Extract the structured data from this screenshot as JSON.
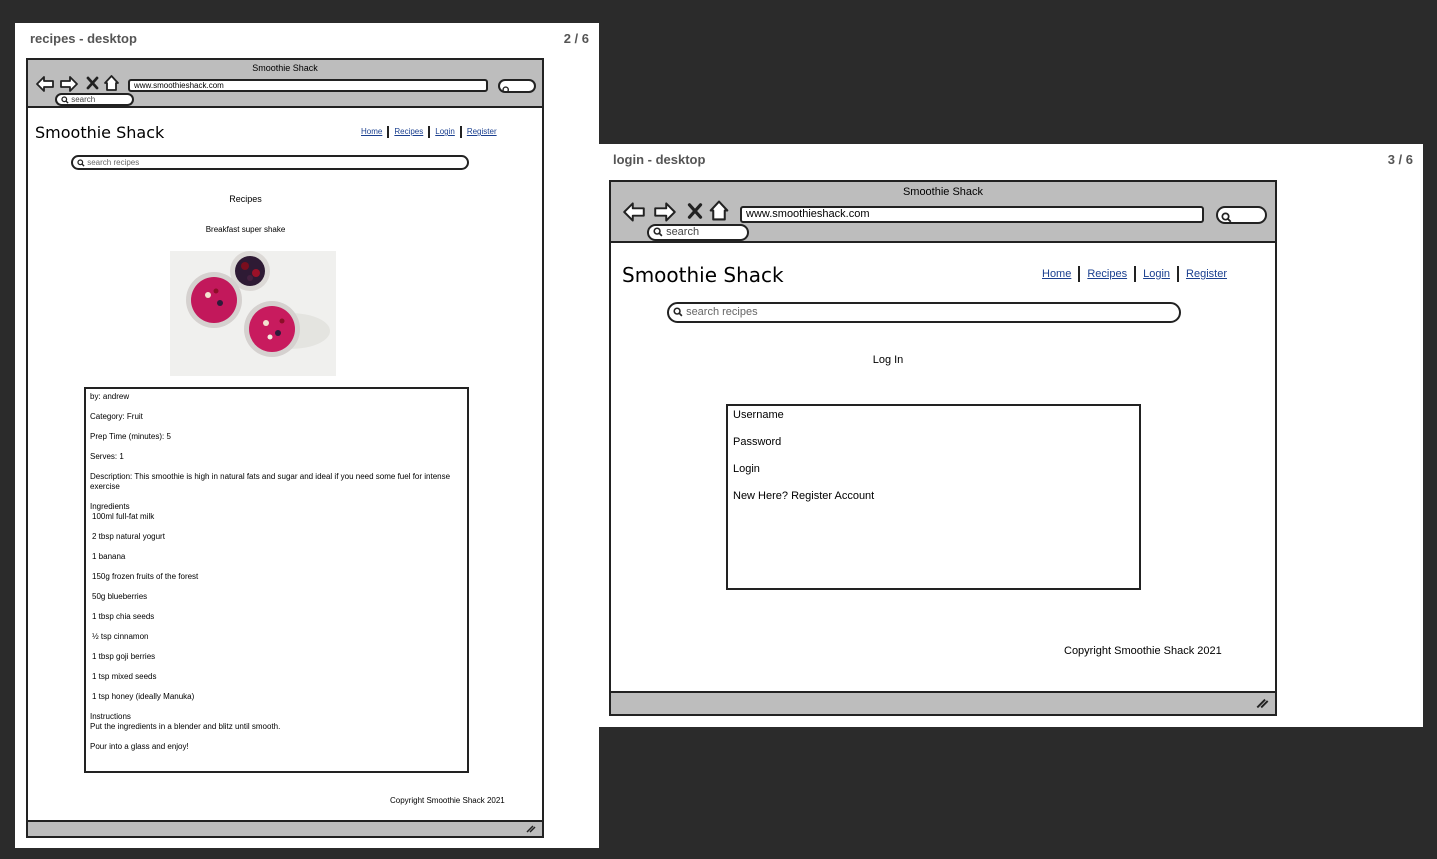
{
  "recipes_page": {
    "sheet_title": "recipes - desktop",
    "page_indicator": "2 / 6",
    "browser": {
      "window_title": "Smoothie Shack",
      "url": "www.smoothieshack.com",
      "search_placeholder": "search"
    },
    "site": {
      "title": "Smoothie Shack",
      "nav": [
        "Home",
        "Recipes",
        "Login",
        "Register"
      ],
      "search_placeholder": "search recipes"
    },
    "heading": "Recipes",
    "recipe_name": "Breakfast super shake",
    "details": {
      "by": "by: andrew",
      "category": "Category: Fruit",
      "prep_time": "Prep Time (minutes): 5",
      "serves": "Serves: 1",
      "description": "Description: This smoothie is high in natural fats and sugar and ideal if you need some fuel for intense exercise",
      "ingredients_label": "Ingredients",
      "ingredients": [
        "100ml full-fat milk",
        "2 tbsp natural yogurt",
        "1 banana",
        "150g frozen fruits of the forest",
        "50g blueberries",
        "1 tbsp chia seeds",
        "½ tsp cinnamon",
        "1 tbsp goji berries",
        "1 tsp mixed seeds",
        "1 tsp honey (ideally Manuka)"
      ],
      "instructions_label": "Instructions",
      "instructions": "Put the ingredients in a blender and blitz until smooth.",
      "closing": "Pour into a glass and enjoy!"
    },
    "copyright": "Copyright Smoothie Shack 2021"
  },
  "login_page": {
    "sheet_title": "login - desktop",
    "page_indicator": "3 / 6",
    "browser": {
      "window_title": "Smoothie Shack",
      "url": "www.smoothieshack.com",
      "search_placeholder": "search"
    },
    "site": {
      "title": "Smoothie Shack",
      "nav": [
        "Home",
        "Recipes",
        "Login",
        "Register"
      ],
      "search_placeholder": "search recipes"
    },
    "heading": "Log In",
    "form": {
      "username_label": "Username",
      "password_label": "Password",
      "login_label": "Login",
      "register_label": "New Here? Register Account"
    },
    "copyright": "Copyright Smoothie Shack 2021"
  },
  "colors": {
    "background": "#2b2b2b",
    "chrome": "#bdbdbd",
    "link": "#1a3f8f"
  },
  "icons": [
    "back-arrow-icon",
    "forward-arrow-icon",
    "close-icon",
    "home-icon",
    "magnifier-icon",
    "resize-grip-icon"
  ]
}
